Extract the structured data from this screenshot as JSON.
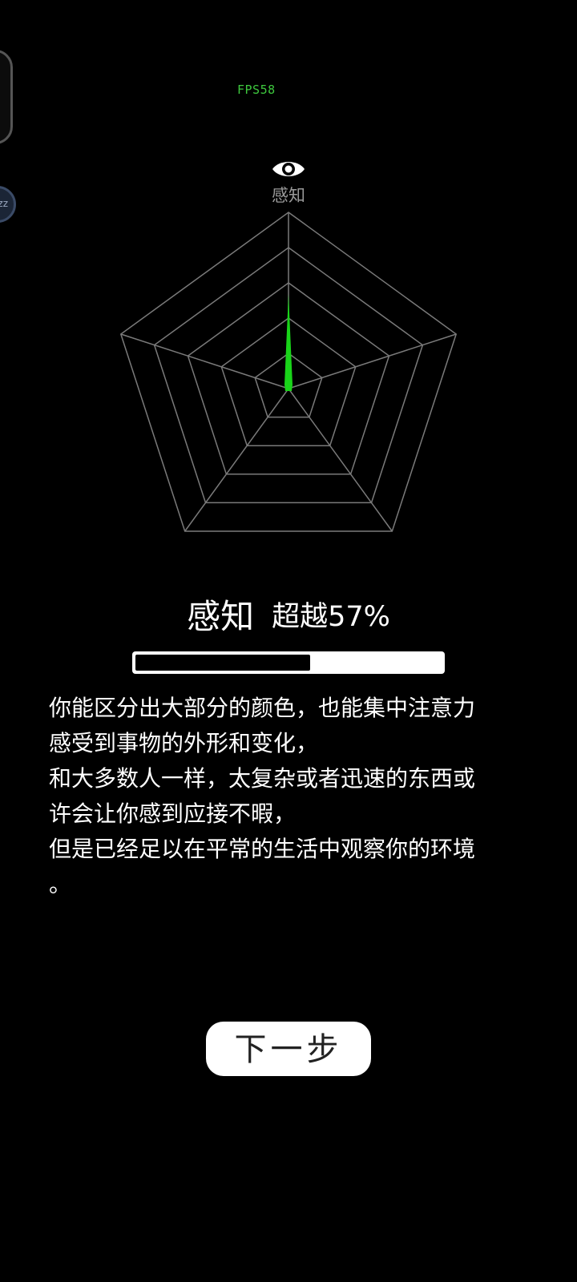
{
  "fps": "FPS58",
  "overlay": {
    "bubble_label": "zz"
  },
  "radar": {
    "axis_label": "感知",
    "icon": "eye-icon",
    "line_color": "#7a7a7a",
    "fill_color": "#19d419"
  },
  "result": {
    "attribute": "感知",
    "percentile_text": "超越57%",
    "progress": 0.57
  },
  "description": [
    "你能区分出大部分的颜色，也能集中注意力",
    "感受到事物的外形和变化，",
    "和大多数人一样，太复杂或者迅速的东西或",
    "许会让你感到应接不暇，",
    "但是已经足以在平常的生活中观察你的环境",
    "。"
  ],
  "next_button": {
    "label": "下一步"
  }
}
